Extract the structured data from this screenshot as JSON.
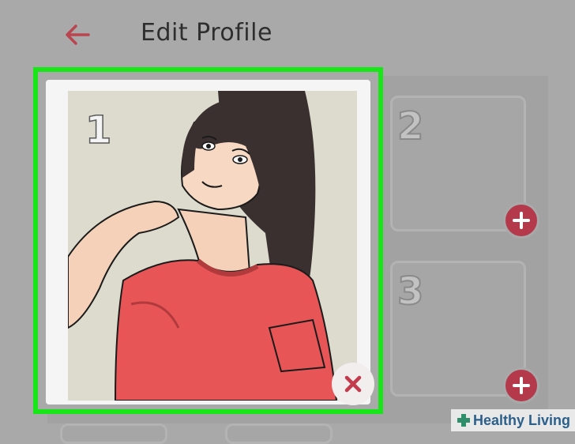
{
  "header": {
    "title": "Edit Profile",
    "back_icon": "back-arrow-icon",
    "accent_color": "#b84550"
  },
  "photos": {
    "main_slot_number": "1",
    "slots": [
      {
        "number": "2",
        "action_icon": "plus-icon"
      },
      {
        "number": "3",
        "action_icon": "plus-icon"
      }
    ],
    "remove_icon": "close-icon",
    "highlight_color": "#19e619"
  },
  "watermark": {
    "text": "Healthy Living",
    "icon": "cross-logo-icon"
  }
}
